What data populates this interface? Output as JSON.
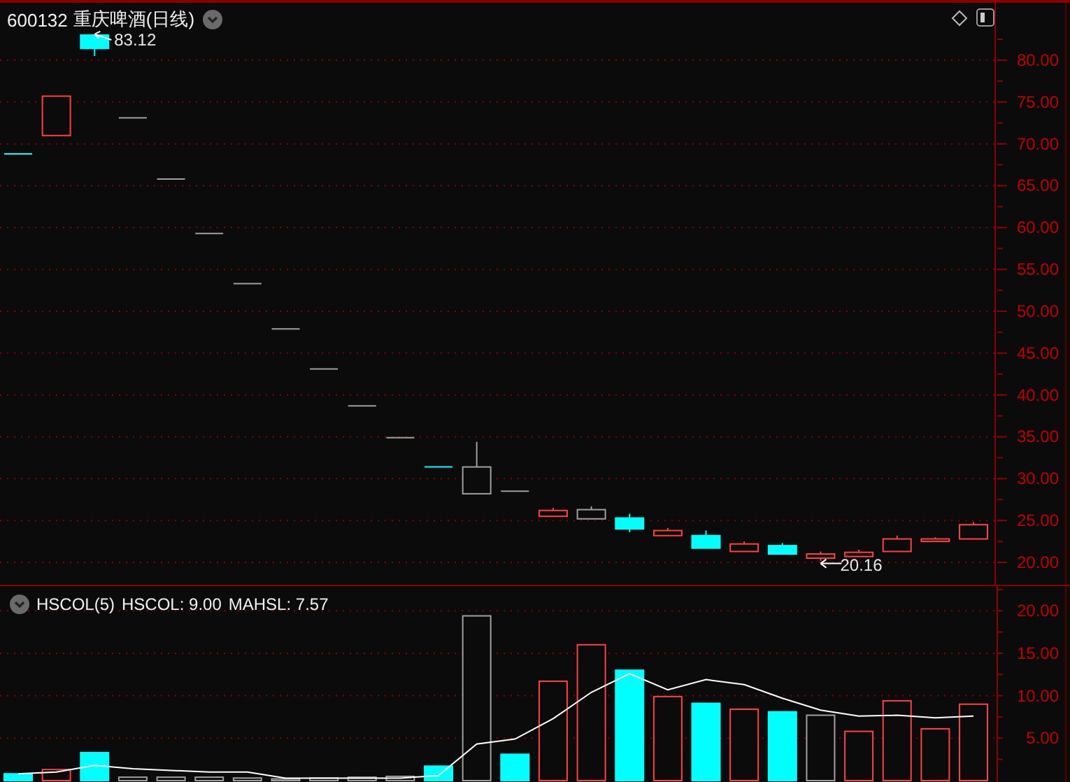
{
  "header": {
    "code": "600132",
    "name": "重庆啤酒(日线)"
  },
  "price_panel": {
    "axis_labels": [
      "80.00",
      "75.00",
      "70.00",
      "65.00",
      "60.00",
      "55.00",
      "50.00",
      "45.00",
      "40.00",
      "35.00",
      "30.00",
      "25.00",
      "20.00"
    ],
    "annotations": [
      "83.12",
      "20.16"
    ]
  },
  "volume_panel": {
    "title": "HSCOL(5)",
    "readings": [
      ": 9.00",
      ": 7.57"
    ],
    "chart_data": {
      "type": "bar",
      "ylim": [
        0,
        22.9
      ],
      "grid": true,
      "yticks": [
        {
          "value": 5,
          "label": "5.00"
        },
        {
          "value": 10,
          "label": "10.00"
        },
        {
          "value": 15,
          "label": "15.00"
        },
        {
          "value": 20,
          "label": "20.00"
        }
      ],
      "series": [
        {
          "name": "HSCOL",
          "colors": [
            "#00ffff",
            "#ff4040",
            "#00ffff",
            "#a0a0a0",
            "#a0a0a0",
            "#a0a0a0",
            "#a0a0a0",
            "#a0a0a0",
            "#a0a0a0",
            "#a0a0a0",
            "#a0a0a0",
            "#00ffff",
            "#a0a0a0",
            "#00ffff",
            "#ff4040",
            "#ff4040",
            "#00ffff",
            "#ff4040",
            "#00ffff",
            "#ff4040",
            "#00ffff",
            "#a0a0a0",
            "#ff4040",
            "#ff4040",
            "#ff4040",
            "#ff4040"
          ],
          "values": [
            0.8,
            1.3,
            3.3,
            0.4,
            0.4,
            0.4,
            0.3,
            0.2,
            0.3,
            0.4,
            0.5,
            1.7,
            19.4,
            3.1,
            11.7,
            16.0,
            13.0,
            9.9,
            9.1,
            8.4,
            8.1,
            7.7,
            5.8,
            9.4,
            6.1,
            9.0
          ]
        },
        {
          "name": "MAHSL",
          "type": "line",
          "color": "#ffffff",
          "values": [
            0.8,
            1.0,
            1.8,
            1.4,
            1.2,
            1.0,
            1.0,
            0.3,
            0.3,
            0.3,
            0.3,
            0.6,
            4.3,
            4.9,
            7.3,
            10.4,
            12.6,
            10.7,
            11.9,
            11.3,
            9.7,
            8.3,
            7.6,
            7.7,
            7.4,
            7.6
          ]
        }
      ]
    }
  }
}
